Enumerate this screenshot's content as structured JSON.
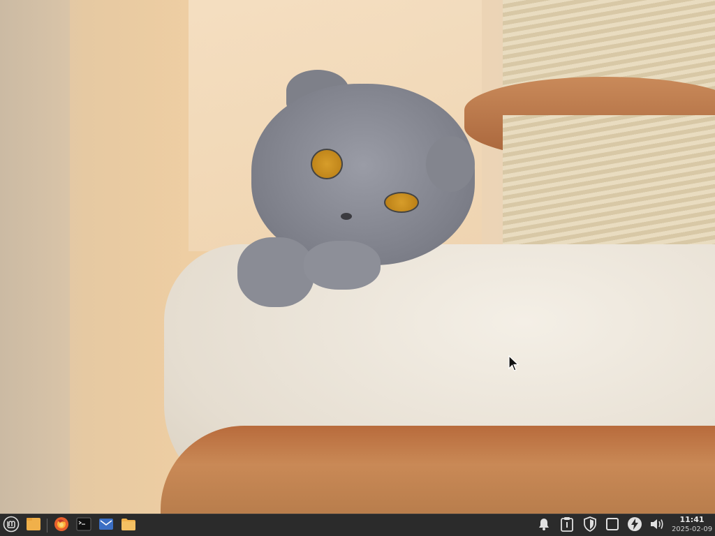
{
  "desktop": {
    "wallpaper": "grey-scottish-fold-cat-on-cat-tree"
  },
  "taskbar": {
    "background": "#2b2b2b",
    "launchers": [
      {
        "name": "menu-icon"
      },
      {
        "name": "show-desktop-icon"
      },
      {
        "name": "firefox-icon"
      },
      {
        "name": "terminal-icon"
      },
      {
        "name": "mail-icon"
      },
      {
        "name": "files-icon"
      }
    ],
    "tray": [
      {
        "name": "notifications-icon"
      },
      {
        "name": "clipboard-icon"
      },
      {
        "name": "shield-icon"
      },
      {
        "name": "window-icon"
      },
      {
        "name": "power-icon"
      },
      {
        "name": "volume-icon"
      }
    ],
    "clock": {
      "time": "11:41",
      "date": "2025-02-09"
    }
  },
  "colors": {
    "accent": "#f0a030",
    "firefox": "#e8602c",
    "mail": "#3b6fc4"
  }
}
